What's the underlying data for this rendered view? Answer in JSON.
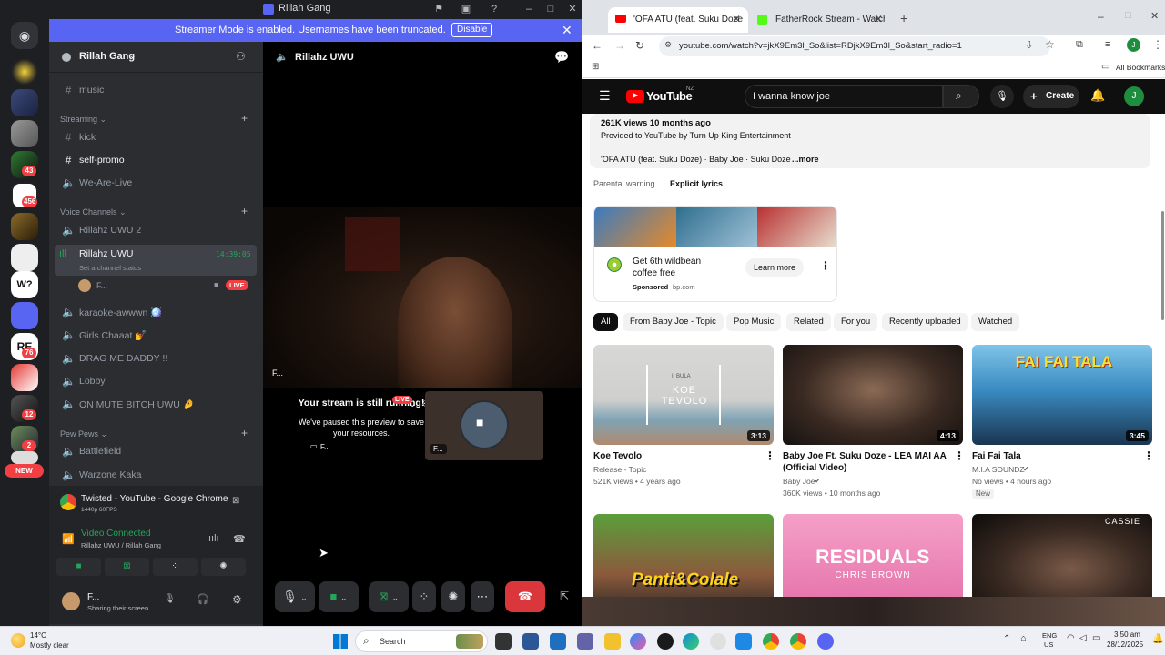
{
  "discord": {
    "window_title": "Rillah Gang",
    "banner": {
      "text": "Streamer Mode is enabled. Usernames have been truncated.",
      "button": "Disable"
    },
    "server_badges": [
      "43",
      "456",
      "12",
      "2",
      "76"
    ],
    "server_initials": {
      "w": "W?",
      "re": "RE"
    },
    "new_label": "NEW",
    "guild_name": "Rillah Gang",
    "channels": {
      "music": "music",
      "streaming_category": "Streaming",
      "kick": "kick",
      "self_promo": "self-promo",
      "we_are_live": "We-Are-Live",
      "voice_category": "Voice Channels",
      "uwu2": "Rillahz UWU 2",
      "uwu": "Rillahz UWU",
      "uwu_time": "14:39:05",
      "uwu_status": "Set a channel status",
      "member": "F...",
      "live": "LIVE",
      "karaoke": "karaoke-awwwn 🪩",
      "girls": "Girls Chaaat 💅",
      "drag": "DRAG ME DADDY !!",
      "lobby": "Lobby",
      "mute": "ON MUTE BITCH UWU 🤌",
      "pew_category": "Pew Pews",
      "battlefield": "Battlefield",
      "warzone": "Warzone Kaka"
    },
    "stream_panel": {
      "title": "Twisted - YouTube - Google Chrome",
      "quality": "1440p 60FPS",
      "vc_status": "Video Connected",
      "vc_location": "Rillahz UWU / Rillah Gang"
    },
    "user_panel": {
      "name": "F...",
      "status": "Sharing their screen"
    },
    "main": {
      "channel_title": "Rillahz UWU",
      "video_label": "F...",
      "paused_title": "Your stream is still running!",
      "paused_body": "We've paused this preview to save your resources.",
      "preview_live": "LIVE",
      "preview_label": "F...",
      "preview_name": "F..."
    }
  },
  "chrome": {
    "tabs": [
      {
        "label": "'OFA ATU (feat. Suku Doze) - Yo",
        "active": true
      },
      {
        "label": "FatherRock Stream - Watch Live",
        "active": false
      }
    ],
    "url": "youtube.com/watch?v=jkX9Em3l_So&list=RDjkX9Em3l_So&start_radio=1",
    "all_bookmarks": "All Bookmarks",
    "profile_initial": "J"
  },
  "youtube": {
    "logo_text": "YouTube",
    "region": "NZ",
    "search_query": "I wanna know joe",
    "create_label": "Create",
    "avatar_initial": "J",
    "description": {
      "views_line": "261K views  10 months ago",
      "provided": "Provided to YouTube by Turn Up King Entertainment",
      "track": "'OFA ATU (feat. Suku Doze) · Baby Joe · Suku Doze",
      "more": "...more"
    },
    "parental_warning": "Parental warning",
    "explicit_lyrics": "Explicit lyrics",
    "ad": {
      "title": "Get 6th wildbean coffee free",
      "sponsored": "Sponsored",
      "domain": "bp.com",
      "cta": "Learn more"
    },
    "chips": [
      "All",
      "From Baby Joe - Topic",
      "Pop Music",
      "Related",
      "For you",
      "Recently uploaded",
      "Watched"
    ],
    "videos": [
      {
        "title": "Koe Tevolo",
        "channel": "Release - Topic",
        "meta": "521K views • 4 years ago",
        "duration": "3:13",
        "thumb_text1": "I, BULA",
        "thumb_text2": "KOE TEVOLO"
      },
      {
        "title": "Baby Joe Ft.  Suku Doze  - LEA MAI AA (Official Video)",
        "channel": "Baby Joe",
        "meta": "360K views • 10 months ago",
        "duration": "4:13"
      },
      {
        "title": "Fai Fai Tala",
        "channel": "M.I.A SOUNDZ",
        "meta": "No views • 4 hours ago",
        "badge": "New",
        "duration": "3:45",
        "thumb_text": "FAI FAI TALA"
      },
      {
        "thumb_text": "Panti&Colale"
      },
      {
        "thumb_text1": "RESIDUALS",
        "thumb_text2": "CHRIS BROWN"
      },
      {
        "thumb_text": "CASSIE"
      }
    ]
  },
  "taskbar": {
    "temp": "14°C",
    "weather": "Mostly clear",
    "search": "Search",
    "lang1": "ENG",
    "lang2": "US",
    "time": "3:50 am",
    "date": "28/12/2025"
  }
}
